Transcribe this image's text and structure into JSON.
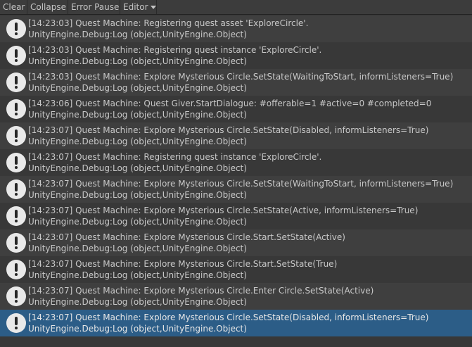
{
  "toolbar": {
    "clear": "Clear",
    "collapse": "Collapse",
    "error_pause": "Error Pause",
    "editor": "Editor"
  },
  "colors": {
    "background": "#383838",
    "row_alt": "#3f3f3f",
    "selected": "#2c5d87",
    "icon": "#e9e9e9"
  },
  "log": [
    {
      "message": "[14:23:03] Quest Machine: Registering quest asset 'ExploreCircle'.",
      "trace": "UnityEngine.Debug:Log (object,UnityEngine.Object)"
    },
    {
      "message": "[14:23:03] Quest Machine: Registering quest instance 'ExploreCircle'.",
      "trace": "UnityEngine.Debug:Log (object,UnityEngine.Object)"
    },
    {
      "message": "[14:23:03] Quest Machine: Explore Mysterious Circle.SetState(WaitingToStart, informListeners=True)",
      "trace": "UnityEngine.Debug:Log (object,UnityEngine.Object)"
    },
    {
      "message": "[14:23:06] Quest Machine: Quest Giver.StartDialogue: #offerable=1 #active=0 #completed=0",
      "trace": "UnityEngine.Debug:Log (object,UnityEngine.Object)"
    },
    {
      "message": "[14:23:07] Quest Machine: Explore Mysterious Circle.SetState(Disabled, informListeners=True)",
      "trace": "UnityEngine.Debug:Log (object,UnityEngine.Object)"
    },
    {
      "message": "[14:23:07] Quest Machine: Registering quest instance 'ExploreCircle'.",
      "trace": "UnityEngine.Debug:Log (object,UnityEngine.Object)"
    },
    {
      "message": "[14:23:07] Quest Machine: Explore Mysterious Circle.SetState(WaitingToStart, informListeners=True)",
      "trace": "UnityEngine.Debug:Log (object,UnityEngine.Object)"
    },
    {
      "message": "[14:23:07] Quest Machine: Explore Mysterious Circle.SetState(Active, informListeners=True)",
      "trace": "UnityEngine.Debug:Log (object,UnityEngine.Object)"
    },
    {
      "message": "[14:23:07] Quest Machine: Explore Mysterious Circle.Start.SetState(Active)",
      "trace": "UnityEngine.Debug:Log (object,UnityEngine.Object)"
    },
    {
      "message": "[14:23:07] Quest Machine: Explore Mysterious Circle.Start.SetState(True)",
      "trace": "UnityEngine.Debug:Log (object,UnityEngine.Object)"
    },
    {
      "message": "[14:23:07] Quest Machine: Explore Mysterious Circle.Enter Circle.SetState(Active)",
      "trace": "UnityEngine.Debug:Log (object,UnityEngine.Object)"
    },
    {
      "message": "[14:23:07] Quest Machine: Explore Mysterious Circle.SetState(Disabled, informListeners=True)",
      "trace": "UnityEngine.Debug:Log (object,UnityEngine.Object)",
      "selected": true
    }
  ]
}
